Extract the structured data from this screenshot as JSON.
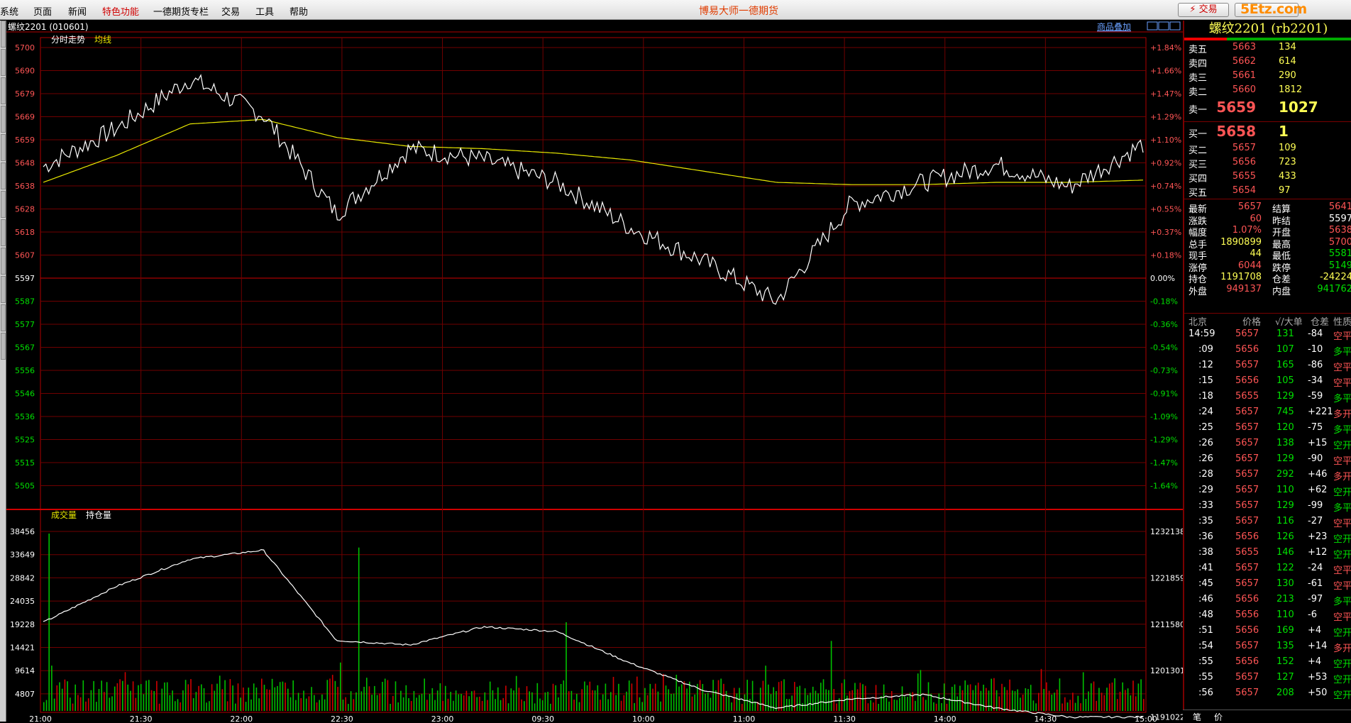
{
  "menu": [
    "系统",
    "页面",
    "新闻",
    "特色功能",
    "一德期货专栏",
    "交易",
    "工具",
    "帮助"
  ],
  "app_title": "博易大师一德期货",
  "trade_button": "交易",
  "watermark": "5Etz.com",
  "chart": {
    "instrument": "螺纹2201 (010601)",
    "label_intraday": "分时走势",
    "label_avg": "均线",
    "overlay_link": "商品叠加",
    "label_volume": "成交量",
    "label_oi": "持仓量",
    "price_axis": [
      "5700",
      "5690",
      "5679",
      "5669",
      "5659",
      "5648",
      "5638",
      "5628",
      "5618",
      "5607",
      "5597",
      "5587",
      "5577",
      "5567",
      "5556",
      "5546",
      "5536",
      "5525",
      "5515",
      "5505"
    ],
    "pct_axis": [
      "+1.84%",
      "+1.66%",
      "+1.47%",
      "+1.29%",
      "+1.10%",
      "+0.92%",
      "+0.74%",
      "+0.55%",
      "+0.37%",
      "+0.18%",
      "0.00%",
      "-0.18%",
      "-0.36%",
      "-0.54%",
      "-0.73%",
      "-0.91%",
      "-1.09%",
      "-1.29%",
      "-1.47%",
      "-1.64%"
    ],
    "volume_axis": [
      "38456",
      "33649",
      "28842",
      "24035",
      "19228",
      "14421",
      "9614",
      "4807"
    ],
    "oi_axis": [
      "1232138",
      "1221859",
      "1211580",
      "1201301",
      "1191022"
    ],
    "time_axis": [
      "21:00",
      "21:30",
      "22:00",
      "22:30",
      "23:00",
      "09:30",
      "10:00",
      "11:00",
      "11:30",
      "14:00",
      "14:30",
      "15:00"
    ]
  },
  "chart_data": {
    "type": "line",
    "title": "螺纹2201 (010601)",
    "x": [
      "21:00",
      "21:30",
      "22:00",
      "22:30",
      "23:00",
      "09:30",
      "10:00",
      "11:00",
      "11:30",
      "14:00",
      "14:30",
      "15:00"
    ],
    "prev_settle": 5597,
    "ylim": [
      5505,
      5700
    ],
    "series": [
      {
        "name": "分时走势",
        "values": [
          5647,
          5664,
          5686,
          5670,
          5626,
          5655,
          5650,
          5640,
          5620,
          5605,
          5587,
          5630,
          5640,
          5648,
          5638,
          5657
        ]
      },
      {
        "name": "均线",
        "values": [
          5640,
          5652,
          5666,
          5668,
          5660,
          5656,
          5655,
          5653,
          5650,
          5645,
          5640,
          5639,
          5639,
          5640,
          5640,
          5641
        ]
      }
    ],
    "volume_ylim": [
      0,
      38456
    ],
    "oi_ylim": [
      1191022,
      1232138
    ],
    "oi_series": [
      1212000,
      1220000,
      1226000,
      1228000,
      1208000,
      1207000,
      1211000,
      1210000,
      1203000,
      1197000,
      1193000,
      1195000,
      1196000,
      1193000,
      1191000,
      1191022
    ]
  },
  "quote": {
    "title": "螺纹2201 (rb2201)",
    "asks": [
      {
        "label": "卖五",
        "price": "5663",
        "vol": "134"
      },
      {
        "label": "卖四",
        "price": "5662",
        "vol": "614"
      },
      {
        "label": "卖三",
        "price": "5661",
        "vol": "290"
      },
      {
        "label": "卖二",
        "price": "5660",
        "vol": "1812"
      },
      {
        "label": "卖一",
        "price": "5659",
        "vol": "1027"
      }
    ],
    "bids": [
      {
        "label": "买一",
        "price": "5658",
        "vol": "1"
      },
      {
        "label": "买二",
        "price": "5657",
        "vol": "109"
      },
      {
        "label": "买三",
        "price": "5656",
        "vol": "723"
      },
      {
        "label": "买四",
        "price": "5655",
        "vol": "433"
      },
      {
        "label": "买五",
        "price": "5654",
        "vol": "97"
      }
    ],
    "stats": [
      {
        "l1": "最新",
        "v1": "5657",
        "c1": "red",
        "l2": "结算",
        "v2": "5641",
        "c2": "red"
      },
      {
        "l1": "涨跌",
        "v1": "60",
        "c1": "red",
        "l2": "昨结",
        "v2": "5597",
        "c2": "wht"
      },
      {
        "l1": "幅度",
        "v1": "1.07%",
        "c1": "red",
        "l2": "开盘",
        "v2": "5638",
        "c2": "red"
      },
      {
        "l1": "总手",
        "v1": "1890899",
        "c1": "yel",
        "l2": "最高",
        "v2": "5700",
        "c2": "red"
      },
      {
        "l1": "现手",
        "v1": "44",
        "c1": "yel",
        "l2": "最低",
        "v2": "5581",
        "c2": "grn"
      },
      {
        "l1": "涨停",
        "v1": "6044",
        "c1": "red",
        "l2": "跌停",
        "v2": "5149",
        "c2": "grn"
      },
      {
        "l1": "持仓",
        "v1": "1191708",
        "c1": "yel",
        "l2": "仓差",
        "v2": "-24224",
        "c2": "yel"
      },
      {
        "l1": "外盘",
        "v1": "949137",
        "c1": "red",
        "l2": "内盘",
        "v2": "941762",
        "c2": "grn"
      }
    ]
  },
  "ticks_header": {
    "time": "北京",
    "price": "价格",
    "vol": "√/大单",
    "oi": "仓差",
    "nature": "性质"
  },
  "ticks": [
    {
      "t": "14:59",
      "p": "5657",
      "pc": "red",
      "v": "131",
      "oi": "-84",
      "n": "空平",
      "nc": "red"
    },
    {
      "t": ":09",
      "p": "5656",
      "pc": "red",
      "v": "107",
      "oi": "-10",
      "n": "多平",
      "nc": "grn"
    },
    {
      "t": ":12",
      "p": "5657",
      "pc": "red",
      "v": "165",
      "oi": "-86",
      "n": "空平",
      "nc": "red"
    },
    {
      "t": ":15",
      "p": "5656",
      "pc": "red",
      "v": "105",
      "oi": "-34",
      "n": "空平",
      "nc": "red"
    },
    {
      "t": ":18",
      "p": "5655",
      "pc": "red",
      "v": "129",
      "oi": "-59",
      "n": "多平",
      "nc": "grn"
    },
    {
      "t": ":24",
      "p": "5657",
      "pc": "red",
      "v": "745",
      "oi": "+221",
      "n": "多开",
      "nc": "red"
    },
    {
      "t": ":25",
      "p": "5657",
      "pc": "red",
      "v": "120",
      "oi": "-75",
      "n": "多平",
      "nc": "grn"
    },
    {
      "t": ":26",
      "p": "5657",
      "pc": "red",
      "v": "138",
      "oi": "+15",
      "n": "空开",
      "nc": "grn"
    },
    {
      "t": ":26",
      "p": "5657",
      "pc": "red",
      "v": "129",
      "oi": "-90",
      "n": "空平",
      "nc": "red"
    },
    {
      "t": ":28",
      "p": "5657",
      "pc": "red",
      "v": "292",
      "oi": "+46",
      "n": "多开",
      "nc": "red"
    },
    {
      "t": ":29",
      "p": "5657",
      "pc": "red",
      "v": "110",
      "oi": "+62",
      "n": "空开",
      "nc": "grn"
    },
    {
      "t": ":33",
      "p": "5657",
      "pc": "red",
      "v": "129",
      "oi": "-99",
      "n": "多平",
      "nc": "grn"
    },
    {
      "t": ":35",
      "p": "5657",
      "pc": "red",
      "v": "116",
      "oi": "-27",
      "n": "空平",
      "nc": "red"
    },
    {
      "t": ":36",
      "p": "5656",
      "pc": "red",
      "v": "126",
      "oi": "+23",
      "n": "空开",
      "nc": "grn"
    },
    {
      "t": ":38",
      "p": "5655",
      "pc": "red",
      "v": "146",
      "oi": "+12",
      "n": "空开",
      "nc": "grn"
    },
    {
      "t": ":41",
      "p": "5657",
      "pc": "red",
      "v": "122",
      "oi": "-24",
      "n": "空平",
      "nc": "red"
    },
    {
      "t": ":45",
      "p": "5657",
      "pc": "red",
      "v": "130",
      "oi": "-61",
      "n": "空平",
      "nc": "red"
    },
    {
      "t": ":46",
      "p": "5656",
      "pc": "red",
      "v": "213",
      "oi": "-97",
      "n": "多平",
      "nc": "grn"
    },
    {
      "t": ":48",
      "p": "5656",
      "pc": "red",
      "v": "110",
      "oi": "-6",
      "n": "空平",
      "nc": "red"
    },
    {
      "t": ":51",
      "p": "5656",
      "pc": "red",
      "v": "169",
      "oi": "+4",
      "n": "空开",
      "nc": "grn"
    },
    {
      "t": ":54",
      "p": "5657",
      "pc": "red",
      "v": "135",
      "oi": "+14",
      "n": "多开",
      "nc": "red"
    },
    {
      "t": ":55",
      "p": "5656",
      "pc": "red",
      "v": "152",
      "oi": "+4",
      "n": "空开",
      "nc": "grn"
    },
    {
      "t": ":55",
      "p": "5657",
      "pc": "red",
      "v": "127",
      "oi": "+53",
      "n": "空开",
      "nc": "grn"
    },
    {
      "t": ":56",
      "p": "5657",
      "pc": "red",
      "v": "208",
      "oi": "+50",
      "n": "空开",
      "nc": "grn"
    }
  ],
  "bottom_tabs": [
    "笔",
    "价"
  ]
}
